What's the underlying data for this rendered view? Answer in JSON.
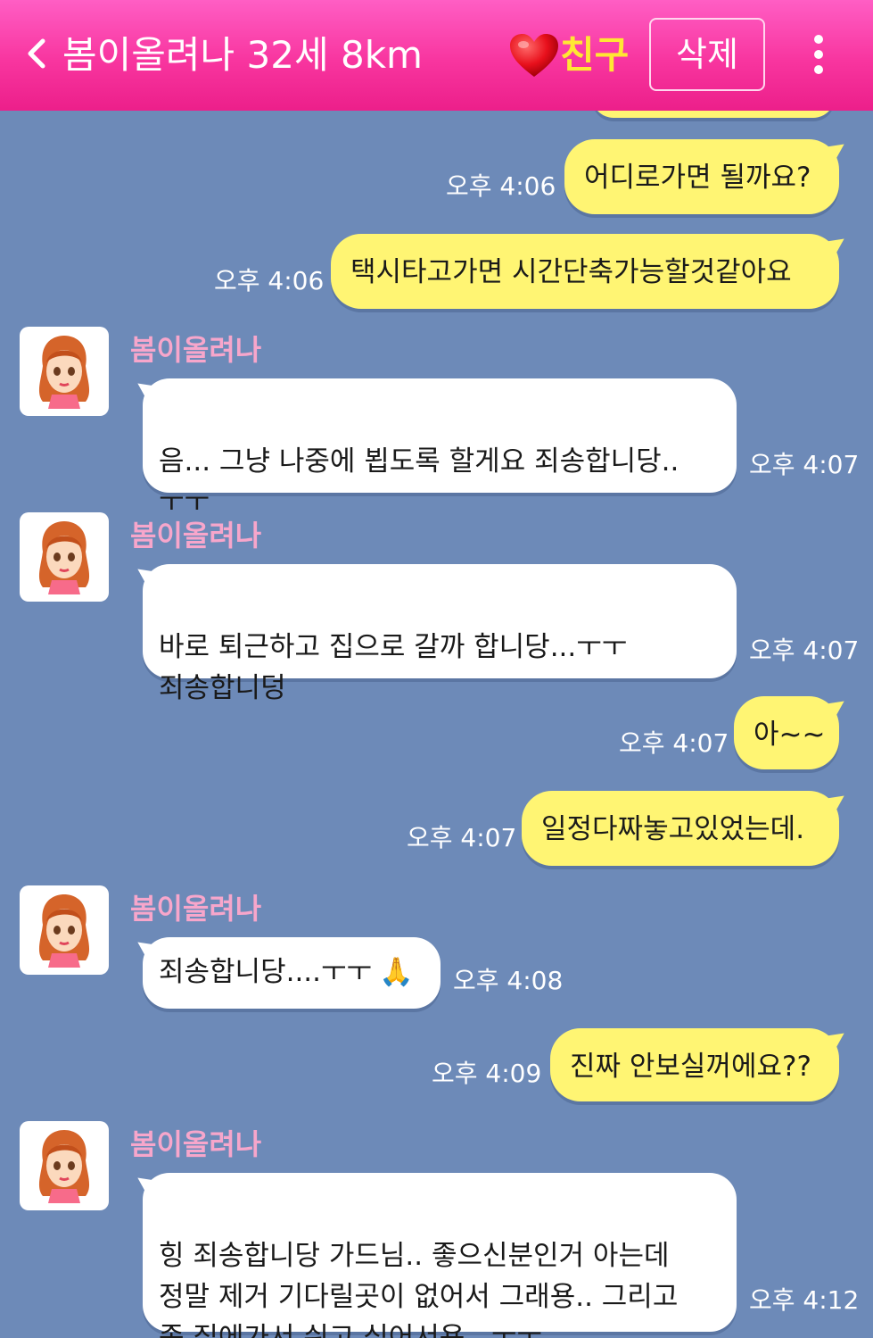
{
  "header": {
    "title": "봄이올려나 32세 8km",
    "friend_label": "친구",
    "delete_label": "삭제"
  },
  "colors": {
    "header_pink": "#f8359f",
    "friend_yellow": "#ffe733",
    "chat_background": "#6d8ab8",
    "my_bubble": "#fff573",
    "their_bubble": "#ffffff",
    "sender_name": "#f7a6cb"
  },
  "sender": {
    "name": "봄이올려나"
  },
  "messages": [
    {
      "from": "me",
      "text": "어디로가면 될까요?",
      "time": "오후 4:06"
    },
    {
      "from": "me",
      "text": "택시타고가면 시간단축가능할것같아요",
      "time": "오후 4:06"
    },
    {
      "from": "them",
      "text": "음... 그냥 나중에 뵙도록 할게요 죄송합니당..\nㅜㅜ",
      "time": "오후 4:07"
    },
    {
      "from": "them",
      "text": "바로 퇴근하고 집으로 갈까 합니당...ㅜㅜ\n죄송합니덩",
      "time": "오후 4:07"
    },
    {
      "from": "me",
      "text": "아~~",
      "time": "오후 4:07"
    },
    {
      "from": "me",
      "text": "일정다짜놓고있었는데.",
      "time": "오후 4:07"
    },
    {
      "from": "them",
      "text": "죄송합니당....ㅜㅜ",
      "emoji": "🙏",
      "time": "오후 4:08"
    },
    {
      "from": "me",
      "text": "진짜 안보실꺼에요??",
      "time": "오후 4:09"
    },
    {
      "from": "them",
      "text": "힝 죄송합니당 가드님.. 좋으신분인거 아는데\n정말 제거 기다릴곳이 없어서 그래용.. 그리고\n좀 집에가서 쉬고 싶어서용...ㅜㅜ",
      "time": "오후 4:12"
    }
  ]
}
